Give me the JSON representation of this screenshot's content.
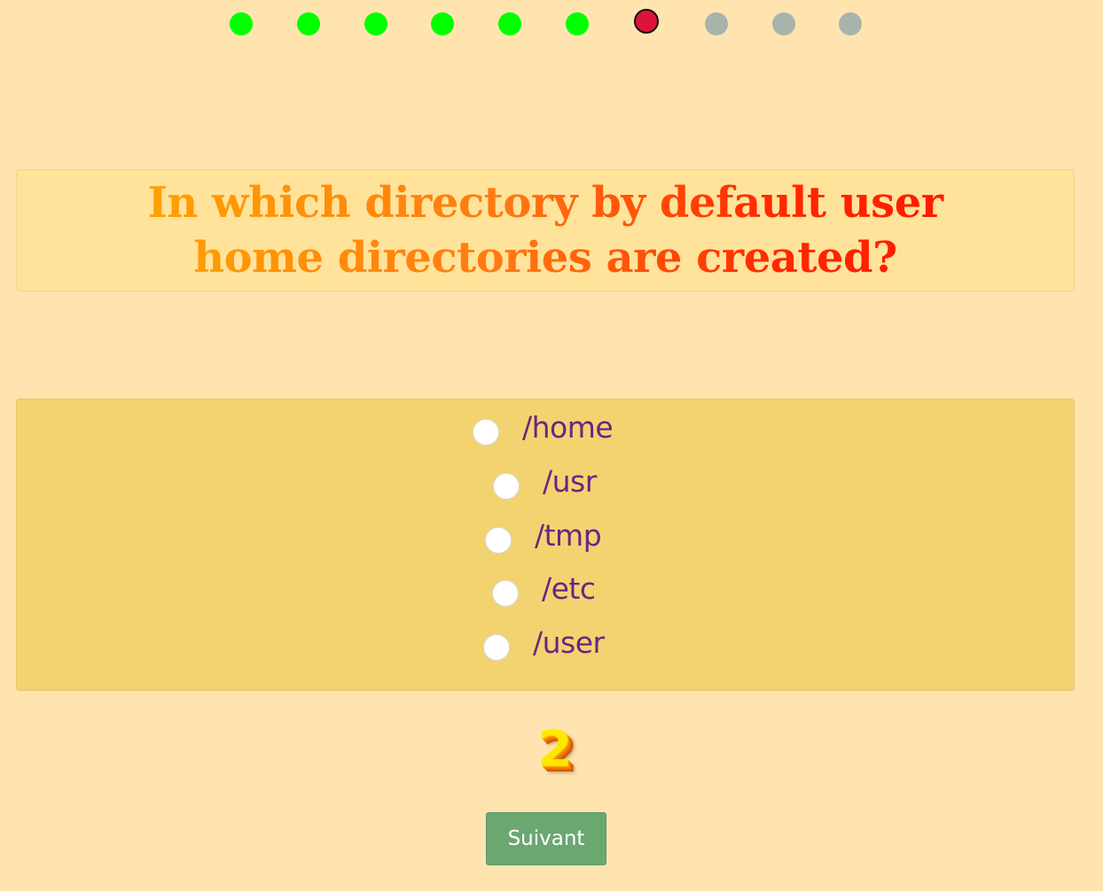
{
  "progress": {
    "total": 10,
    "completed": 6,
    "current_index": 7,
    "colors": {
      "done": "#00ff00",
      "current": "#dc143c",
      "todo": "#a7b3ab"
    }
  },
  "question": {
    "text": "In which directory by default user home directories are created?"
  },
  "answers": [
    {
      "label": "/home"
    },
    {
      "label": "/usr"
    },
    {
      "label": "/tmp"
    },
    {
      "label": "/etc"
    },
    {
      "label": "/user"
    }
  ],
  "counter": {
    "value": "2"
  },
  "next_button": {
    "label": "Suivant"
  }
}
